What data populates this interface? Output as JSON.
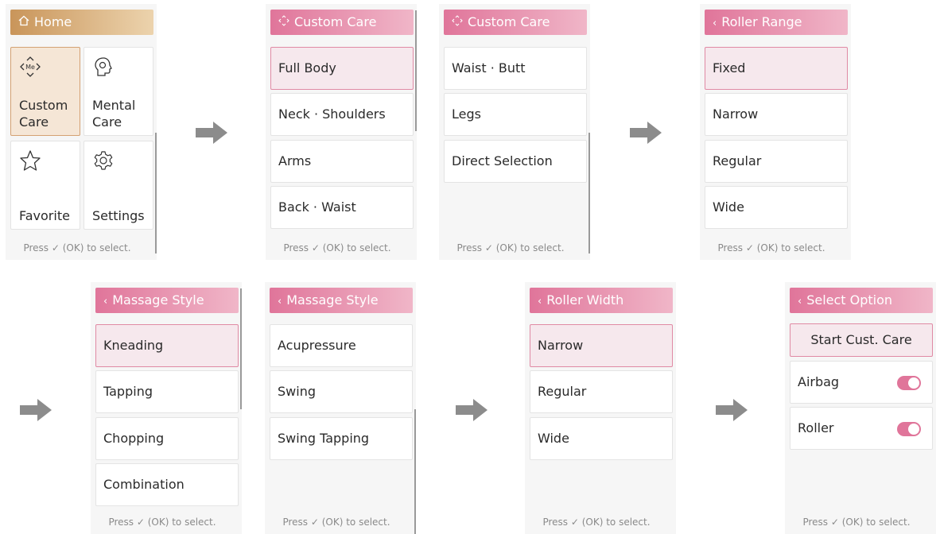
{
  "footer_text": "Press ✓ (OK) to select.",
  "colors": {
    "pink_header": "#e0759a",
    "gold_header": "#c9955a",
    "toggle_on": "#e0759a"
  },
  "home": {
    "title": "Home",
    "title_icon": "home-icon",
    "tiles": [
      {
        "label_line1": "Custom",
        "label_line2": "Care",
        "icon": "custom-care-icon",
        "selected": true
      },
      {
        "label_line1": "Mental",
        "label_line2": "Care",
        "icon": "mental-care-icon"
      },
      {
        "label_line1": "",
        "label_line2": "Favorite",
        "icon": "star-icon"
      },
      {
        "label_line1": "",
        "label_line2": "Settings",
        "icon": "gear-icon"
      }
    ]
  },
  "custom_care_1": {
    "title": "Custom Care",
    "title_icon": "custom-care-icon",
    "items": [
      "Full Body",
      "Neck · Shoulders",
      "Arms",
      "Back · Waist"
    ],
    "selected_index": 0
  },
  "custom_care_2": {
    "title": "Custom Care",
    "title_icon": "custom-care-icon",
    "items": [
      "Waist · Butt",
      "Legs",
      "Direct Selection"
    ]
  },
  "roller_range": {
    "title": "Roller Range",
    "back_icon": "chevron-left-icon",
    "items": [
      "Fixed",
      "Narrow",
      "Regular",
      "Wide"
    ],
    "selected_index": 0
  },
  "massage_style_1": {
    "title": "Massage Style",
    "back_icon": "chevron-left-icon",
    "items": [
      "Kneading",
      "Tapping",
      "Chopping",
      "Combination"
    ],
    "selected_index": 0
  },
  "massage_style_2": {
    "title": "Massage Style",
    "back_icon": "chevron-left-icon",
    "items": [
      "Acupressure",
      "Swing",
      "Swing Tapping"
    ]
  },
  "roller_width": {
    "title": "Roller Width",
    "back_icon": "chevron-left-icon",
    "items": [
      "Narrow",
      "Regular",
      "Wide"
    ],
    "selected_index": 0
  },
  "select_option": {
    "title": "Select Option",
    "back_icon": "chevron-left-icon",
    "start_label": "Start Cust. Care",
    "options": [
      {
        "label": "Airbag",
        "enabled": true
      },
      {
        "label": "Roller",
        "enabled": true
      }
    ]
  }
}
